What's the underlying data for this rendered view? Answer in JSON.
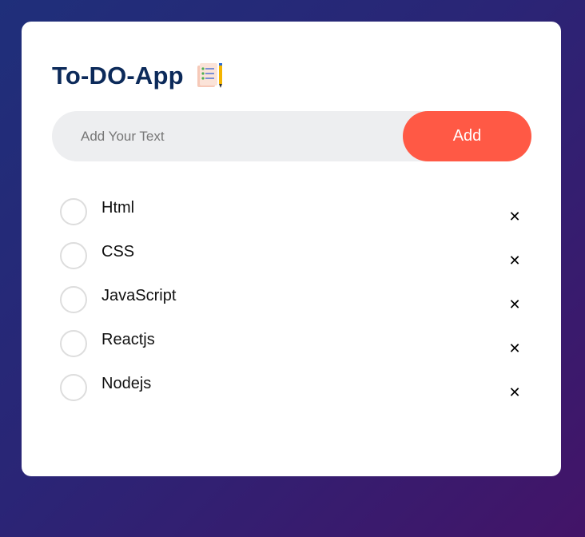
{
  "app": {
    "title": "To-DO-App",
    "title_icon": "checklist-icon"
  },
  "input": {
    "placeholder": "Add Your Text",
    "value": ""
  },
  "add_button": {
    "label": "Add"
  },
  "tasks": [
    {
      "label": "Html",
      "checked": false
    },
    {
      "label": "CSS",
      "checked": false
    },
    {
      "label": "JavaScript",
      "checked": false
    },
    {
      "label": "Reactjs",
      "checked": false
    },
    {
      "label": "Nodejs",
      "checked": false
    }
  ],
  "delete_glyph": "✕",
  "colors": {
    "title": "#0c2a5a",
    "accent": "#ff5945",
    "input_bg": "#edeef0",
    "circle_border": "#dddddd"
  }
}
